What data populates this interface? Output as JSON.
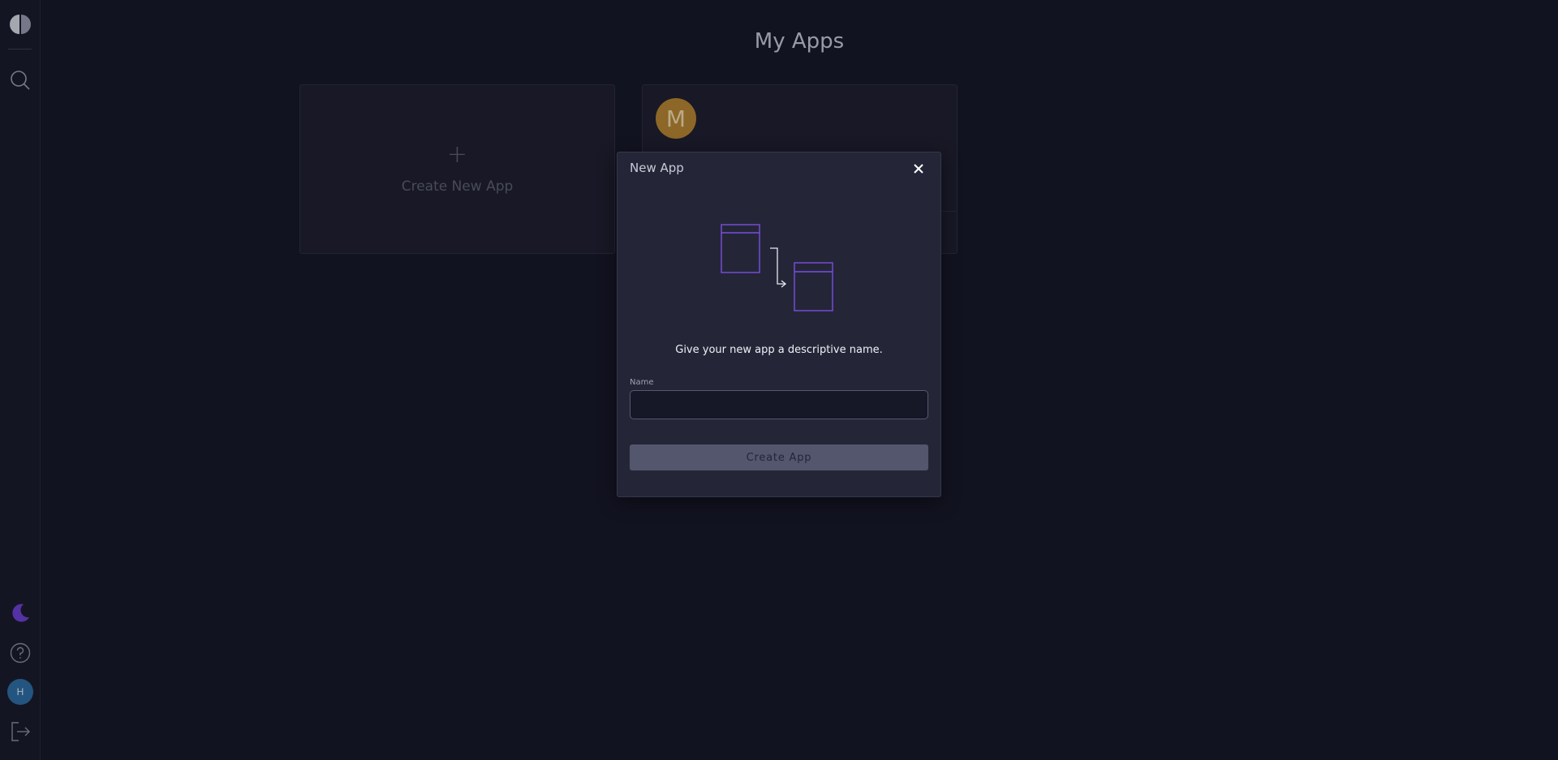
{
  "page": {
    "title": "My Apps"
  },
  "sidebar": {
    "top_icons": [
      "logo-icon",
      "search-icon"
    ],
    "bottom_icons": [
      "moon-icon",
      "help-icon",
      "logout-icon"
    ],
    "user_initial": "H"
  },
  "cards": {
    "create_new": {
      "plus": "+",
      "label": "Create New App"
    },
    "apps": [
      {
        "initial": "M",
        "avatar_color": "#b8862e"
      }
    ]
  },
  "modal": {
    "title": "New App",
    "close_icon": "close-icon",
    "description": "Give your new app a descriptive name.",
    "name_label": "Name",
    "name_value": "",
    "name_placeholder": "",
    "submit_label": "Create App"
  },
  "colors": {
    "background": "#151624",
    "sidebar": "#171827",
    "modal": "#242638",
    "accent_purple": "#7a4fe0",
    "user_avatar": "#2b6ea4",
    "button_disabled": "#53566c"
  }
}
